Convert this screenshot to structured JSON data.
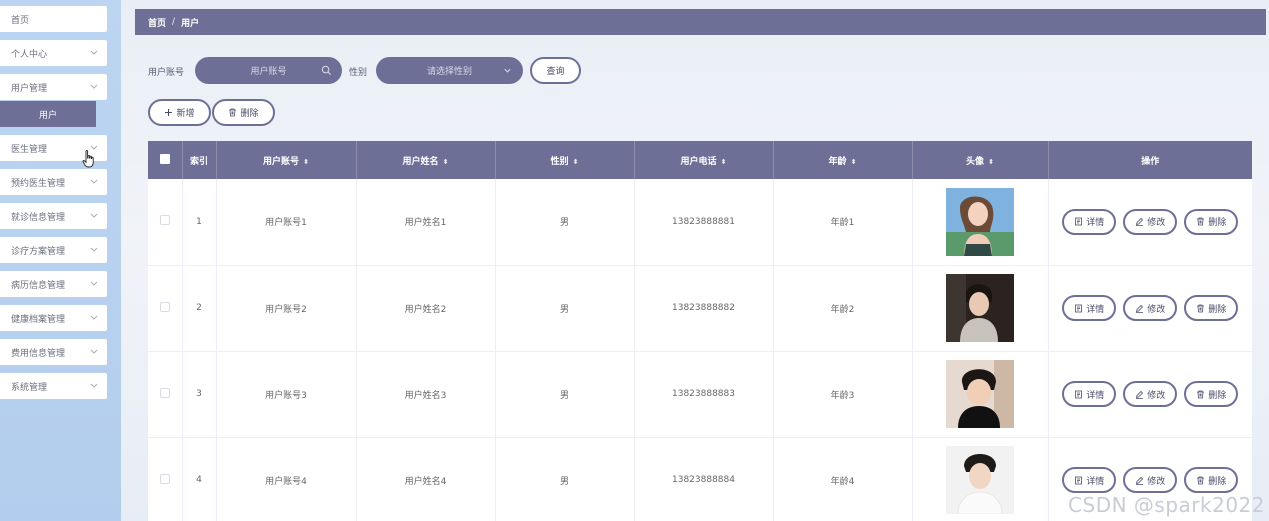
{
  "sidebar": {
    "items": [
      {
        "label": "首页",
        "has_chevron": false
      },
      {
        "label": "个人中心",
        "has_chevron": true
      },
      {
        "label": "用户管理",
        "has_chevron": true
      },
      {
        "label": "医生管理",
        "has_chevron": true
      },
      {
        "label": "预约医生管理",
        "has_chevron": true
      },
      {
        "label": "就诊信息管理",
        "has_chevron": true
      },
      {
        "label": "诊疗方案管理",
        "has_chevron": true
      },
      {
        "label": "病历信息管理",
        "has_chevron": true
      },
      {
        "label": "健康档案管理",
        "has_chevron": true
      },
      {
        "label": "费用信息管理",
        "has_chevron": true
      },
      {
        "label": "系统管理",
        "has_chevron": true
      }
    ],
    "active_sub": "用户"
  },
  "breadcrumb": {
    "home": "首页",
    "separator": "/",
    "current": "用户"
  },
  "search": {
    "account_label": "用户账号",
    "account_placeholder": "用户账号",
    "gender_label": "性别",
    "gender_placeholder": "请选择性别",
    "query_button": "查询"
  },
  "toolbar": {
    "add_button": "新增",
    "delete_button": "删除"
  },
  "table": {
    "headers": {
      "index": "索引",
      "account": "用户账号",
      "name": "用户姓名",
      "gender": "性别",
      "phone": "用户电话",
      "age": "年龄",
      "avatar": "头像",
      "actions": "操作"
    },
    "rows": [
      {
        "index": "1",
        "account": "用户账号1",
        "name": "用户姓名1",
        "gender": "男",
        "phone": "13823888881",
        "age": "年龄1"
      },
      {
        "index": "2",
        "account": "用户账号2",
        "name": "用户姓名2",
        "gender": "男",
        "phone": "13823888882",
        "age": "年龄2"
      },
      {
        "index": "3",
        "account": "用户账号3",
        "name": "用户姓名3",
        "gender": "男",
        "phone": "13823888883",
        "age": "年龄3"
      },
      {
        "index": "4",
        "account": "用户账号4",
        "name": "用户姓名4",
        "gender": "男",
        "phone": "13823888884",
        "age": "年龄4"
      }
    ],
    "row_actions": {
      "detail": "详情",
      "edit": "修改",
      "delete": "删除"
    }
  },
  "watermark": "CSDN @spark2022",
  "colors": {
    "accent": "#6e6f96",
    "sidebar_bg": "#b8d1ef"
  }
}
